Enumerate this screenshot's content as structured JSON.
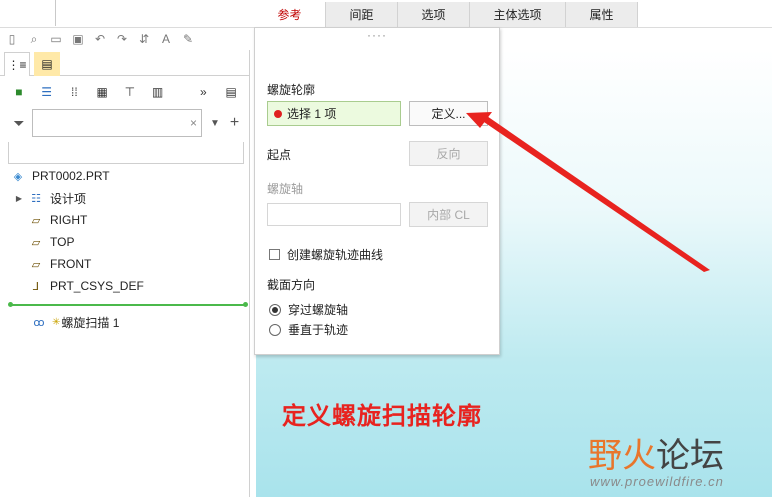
{
  "ribbon_tabs": [
    {
      "label": "参考",
      "active": true
    },
    {
      "label": "间距",
      "active": false
    },
    {
      "label": "选项",
      "active": false
    },
    {
      "label": "主体选项",
      "active": false
    },
    {
      "label": "属性",
      "active": false
    }
  ],
  "filter": {
    "value": "",
    "clear_glyph": "×"
  },
  "tree": {
    "root": "PRT0002.PRT",
    "items": [
      "设计项",
      "RIGHT",
      "TOP",
      "FRONT",
      "PRT_CSYS_DEF"
    ],
    "insert_item": "螺旋扫描 1"
  },
  "dropdown": {
    "dots": "····",
    "profile_label": "螺旋轮廓",
    "profile_value": "选择 1 项",
    "define_button": "定义...",
    "start_label": "起点",
    "reverse_button": "反向",
    "axis_label": "螺旋轴",
    "internal_cl_button": "内部 CL",
    "create_curve_label": "创建螺旋轨迹曲线",
    "section_dir_label": "截面方向",
    "radio_through_axis": "穿过螺旋轴",
    "radio_normal_traj": "垂直于轨迹"
  },
  "annotation": "定义螺旋扫描轮廓",
  "watermark": {
    "part1": "野火",
    "part2": "论坛",
    "url": "www.proewildfire.cn"
  },
  "colors": {
    "accent_red": "#e8231f",
    "active_tab_text": "#c00000",
    "selection_bg": "#ecfadf"
  }
}
